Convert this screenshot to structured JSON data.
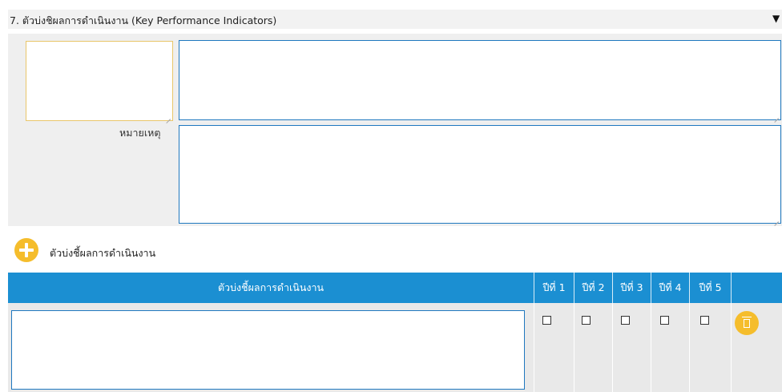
{
  "section": {
    "title": "7. ตัวบ่งชิผลการดำเนินงาน (Key Performance Indicators)",
    "collapse_glyph": "▼"
  },
  "form": {
    "remark_label": "หมายเหตุ"
  },
  "add": {
    "label": "ตัวบ่งชี้ผลการดำเนินงาน"
  },
  "table": {
    "columns": [
      "ตัวบ่งชี้ผลการดำเนินงาน",
      "ปีที่ 1",
      "ปีที่ 2",
      "ปีที่ 3",
      "ปีที่ 4",
      "ปีที่ 5",
      ""
    ],
    "rows": [
      {
        "kpi": "",
        "years": [
          false,
          false,
          false,
          false,
          false
        ]
      }
    ]
  },
  "colors": {
    "header_bg": "#1b8fd2",
    "accent": "#f5bd2c",
    "input_border": "#1f78bf",
    "focus_border": "#e9c66a"
  }
}
